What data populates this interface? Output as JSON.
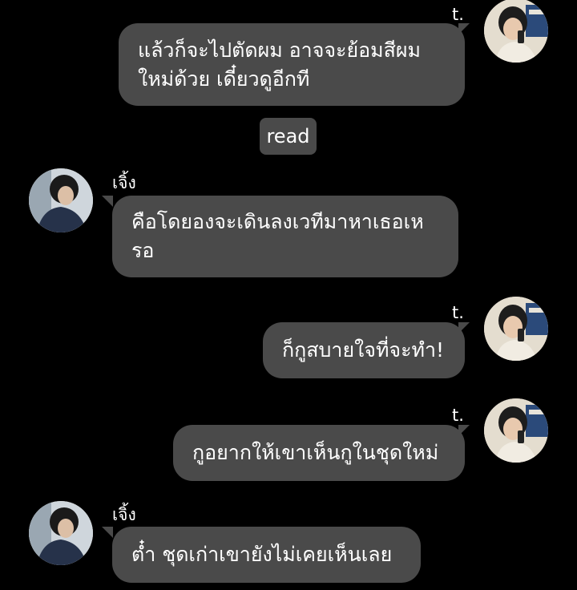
{
  "chat": {
    "other_name": "t.",
    "me_name": "เจิ้ง",
    "read_label": "read",
    "messages": [
      {
        "sender": "t.",
        "text": "แล้วก็จะไปตัดผม อาจจะย้อมสีผม\nใหม่ด้วย เดี๋ยวดูอีกที"
      },
      {
        "sender": "เจิ้ง",
        "text": "คือโดยองจะเดินลงเวทีมาหาเธอเห\nรอ"
      },
      {
        "sender": "t.",
        "text": "ก็กูสบายใจที่จะทำ!"
      },
      {
        "sender": "t.",
        "text": "กูอยากให้เขาเห็นกูในชุดใหม่"
      },
      {
        "sender": "เจิ้ง",
        "text": "ต๋ำ ชุดเก่าเขายังไม่เคยเห็นเลย"
      }
    ]
  },
  "colors": {
    "background": "#000000",
    "bubble": "#4a4a4a",
    "text": "#ffffff"
  },
  "icons": {
    "other_avatar": "avatar-photo",
    "me_avatar": "avatar-photo"
  }
}
